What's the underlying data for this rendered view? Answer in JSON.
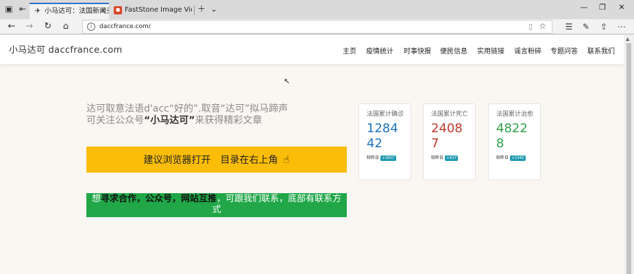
{
  "browser": {
    "tabs": [
      {
        "title": "小马达可：法国新闻头条",
        "active": true,
        "favicon": "plane-icon"
      },
      {
        "title": "FastStone Image Viewer - Pc",
        "active": false,
        "favicon": "faststone-icon"
      }
    ],
    "url": "daccfrance.com/"
  },
  "site": {
    "brand": "小马达可 daccfrance.com",
    "nav": [
      "主页",
      "疫情统计",
      "时事快报",
      "便民信息",
      "实用链接",
      "谣言粉碎",
      "专题问答",
      "联系我们"
    ]
  },
  "intro": {
    "line1": "达可取意法语d'acc“好的”.取音“达可”拟马蹄声",
    "line2_pre": "可关注公众号",
    "line2_bold": "“小马达可”",
    "line2_post": "来获得精彩文章"
  },
  "cta": {
    "label": "建议浏览器打开　目录在右上角"
  },
  "contact": {
    "part1": "想",
    "part2": "寻求合作，公众号，网站互推",
    "part3": "，可跟我们联系，底部有联系方式"
  },
  "stats": [
    {
      "label": "法国累计确诊",
      "value": "128442",
      "compare_label": "较昨日",
      "delta": "+1607",
      "color": "#1e73be",
      "badge_color": "#1f9bb0"
    },
    {
      "label": "法国累计死亡",
      "value": "24087",
      "compare_label": "较昨日",
      "delta": "+427",
      "color": "#c0392b",
      "badge_color": "#1f9bb0"
    },
    {
      "label": "法国累计治愈",
      "value": "48228",
      "compare_label": "较昨日",
      "delta": "+1342",
      "color": "#2e9e44",
      "badge_color": "#1f9bb0"
    }
  ]
}
